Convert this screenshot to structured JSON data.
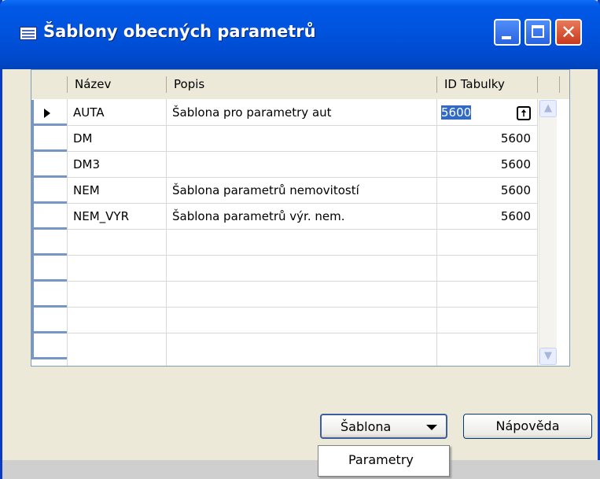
{
  "window": {
    "title": "Šablony obecných parametrů"
  },
  "grid": {
    "columns": [
      "Název",
      "Popis",
      "ID Tabulky"
    ],
    "rows": [
      {
        "name": "AUTA",
        "desc": "Šablona pro parametry aut",
        "id": "5600"
      },
      {
        "name": "DM",
        "desc": "",
        "id": "5600"
      },
      {
        "name": "DM3",
        "desc": "",
        "id": "5600"
      },
      {
        "name": "NEM",
        "desc": "Šablona parametrů nemovitostí",
        "id": "5600"
      },
      {
        "name": "NEM_VYR",
        "desc": "Šablona parametrů výr. nem.",
        "id": "5600"
      }
    ]
  },
  "buttons": {
    "sablona": "Šablona",
    "napoveda": "Nápověda"
  },
  "menu": {
    "items": [
      "Parametry"
    ]
  },
  "icons": {
    "window": "table-icon",
    "minimize": "minimize-icon",
    "maximize": "maximize-icon",
    "close": "close-icon",
    "lookup": "lookup-arrow-icon"
  }
}
